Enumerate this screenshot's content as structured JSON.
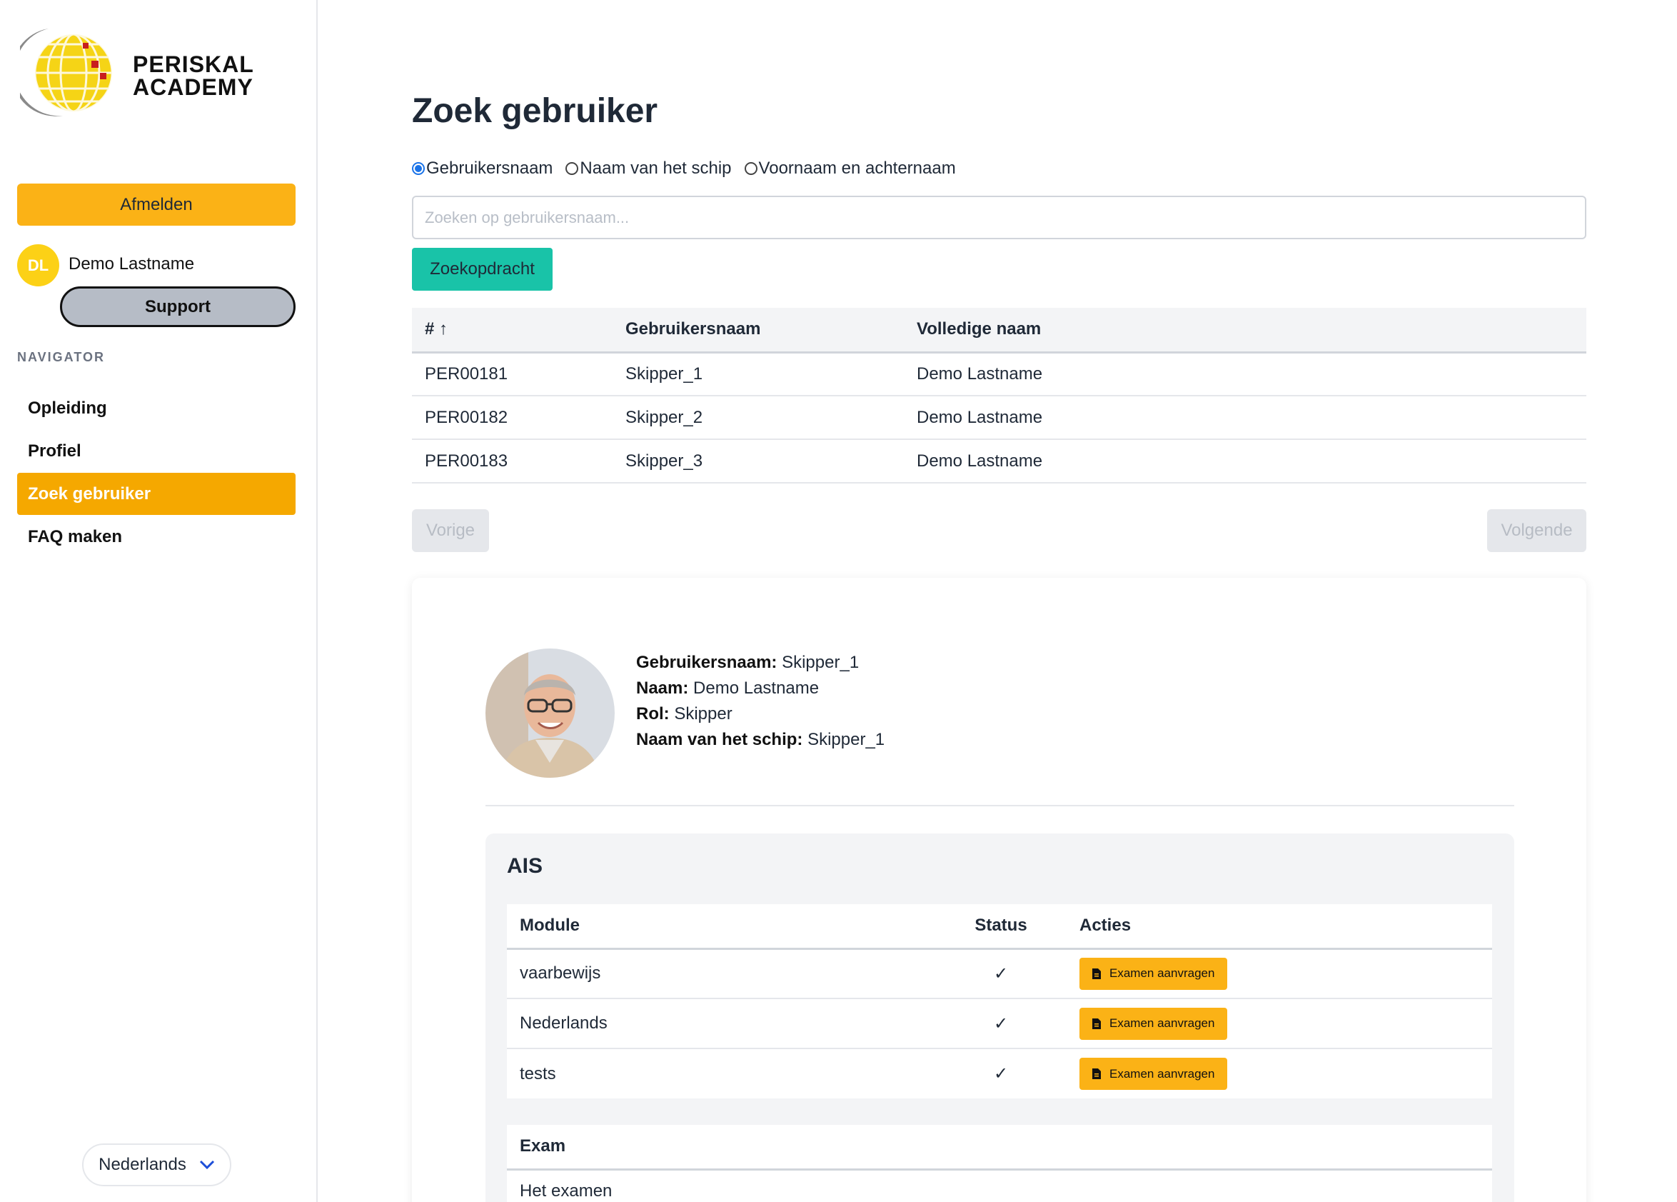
{
  "brand": {
    "line1": "PERISKAL",
    "line2": "ACADEMY"
  },
  "sidebar": {
    "logout_label": "Afmelden",
    "user": {
      "initials": "DL",
      "name": "Demo Lastname"
    },
    "support_label": "Support",
    "nav_title": "NAVIGATOR",
    "items": [
      {
        "label": "Opleiding",
        "active": false
      },
      {
        "label": "Profiel",
        "active": false
      },
      {
        "label": "Zoek gebruiker",
        "active": true
      },
      {
        "label": "FAQ maken",
        "active": false
      }
    ],
    "language": "Nederlands"
  },
  "main": {
    "title": "Zoek gebruiker",
    "search_modes": [
      {
        "label": "Gebruikersnaam",
        "checked": true
      },
      {
        "label": "Naam van het schip",
        "checked": false
      },
      {
        "label": "Voornaam en achternaam",
        "checked": false
      }
    ],
    "search": {
      "placeholder": "Zoeken op gebruikersnaam...",
      "value": ""
    },
    "search_button": "Zoekopdracht",
    "results": {
      "headers": [
        "# ↑",
        "Gebruikersnaam",
        "Volledige naam"
      ],
      "rows": [
        [
          "PER00181",
          "Skipper_1",
          "Demo Lastname"
        ],
        [
          "PER00182",
          "Skipper_2",
          "Demo Lastname"
        ],
        [
          "PER00183",
          "Skipper_3",
          "Demo Lastname"
        ]
      ]
    },
    "prev_label": "Vorige",
    "next_label": "Volgende"
  },
  "profile": {
    "username_label": "Gebruikersnaam:",
    "username": "Skipper_1",
    "name_label": "Naam:",
    "name": "Demo Lastname",
    "role_label": "Rol:",
    "role": "Skipper",
    "ship_label": "Naam van het schip:",
    "ship": "Skipper_1",
    "ais": {
      "title": "AIS",
      "headers": [
        "Module",
        "Status",
        "Acties"
      ],
      "rows": [
        {
          "module": "vaarbewijs",
          "status": "✓",
          "action": "Examen aanvragen"
        },
        {
          "module": "Nederlands",
          "status": "✓",
          "action": "Examen aanvragen"
        },
        {
          "module": "tests",
          "status": "✓",
          "action": "Examen aanvragen"
        }
      ],
      "exam_header": "Exam",
      "exam_rows": [
        "Het examen"
      ]
    }
  },
  "colors": {
    "accent": "#fbb216",
    "active_nav": "#f5a800",
    "search_button": "#19c3a8",
    "check": "#22c55e"
  }
}
